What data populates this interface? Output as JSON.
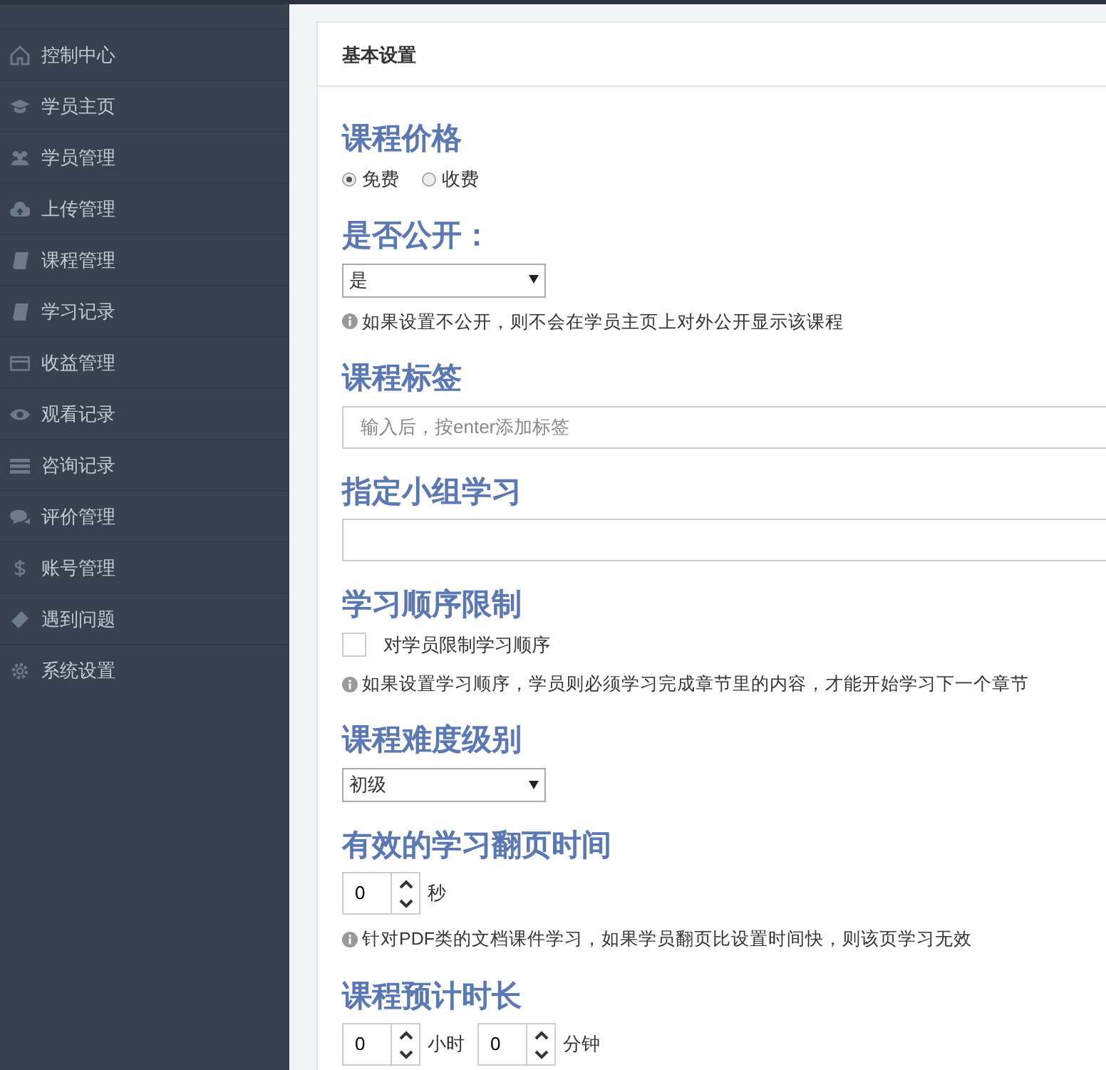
{
  "sidebar": {
    "items": [
      {
        "label": "控制中心"
      },
      {
        "label": "学员主页"
      },
      {
        "label": "学员管理"
      },
      {
        "label": "上传管理"
      },
      {
        "label": "课程管理"
      },
      {
        "label": "学习记录"
      },
      {
        "label": "收益管理"
      },
      {
        "label": "观看记录"
      },
      {
        "label": "咨询记录"
      },
      {
        "label": "评价管理"
      },
      {
        "label": "账号管理"
      },
      {
        "label": "遇到问题"
      },
      {
        "label": "系统设置"
      }
    ]
  },
  "card": {
    "title": "基本设置",
    "sections": [
      {
        "kind": "radio",
        "heading": "课程价格",
        "options": [
          {
            "label": "免费",
            "selected": true
          },
          {
            "label": "收费",
            "selected": false
          }
        ]
      },
      {
        "kind": "select",
        "heading": "是否公开：",
        "value": "是",
        "hint": "如果设置不公开，则不会在学员主页上对外公开显示该课程"
      },
      {
        "kind": "text",
        "heading": "课程标签",
        "placeholder": "输入后，按enter添加标签"
      },
      {
        "kind": "text",
        "heading": "指定小组学习"
      },
      {
        "kind": "checkbox",
        "heading": "学习顺序限制",
        "label": "对学员限制学习顺序",
        "checked": false,
        "hint": "如果设置学习顺序，学员则必须学习完成章节里的内容，才能开始学习下一个章节"
      },
      {
        "kind": "select",
        "heading": "课程难度级别",
        "value": "初级"
      },
      {
        "kind": "number",
        "heading": "有效的学习翻页时间",
        "fields": [
          {
            "value": "0",
            "unit": "秒"
          }
        ],
        "hint": "针对PDF类的文档课件学习，如果学员翻页比设置时间快，则该页学习无效"
      },
      {
        "kind": "number",
        "heading": "课程预计时长",
        "fields": [
          {
            "value": "0",
            "unit": "小时"
          },
          {
            "value": "0",
            "unit": "分钟"
          }
        ]
      }
    ]
  }
}
